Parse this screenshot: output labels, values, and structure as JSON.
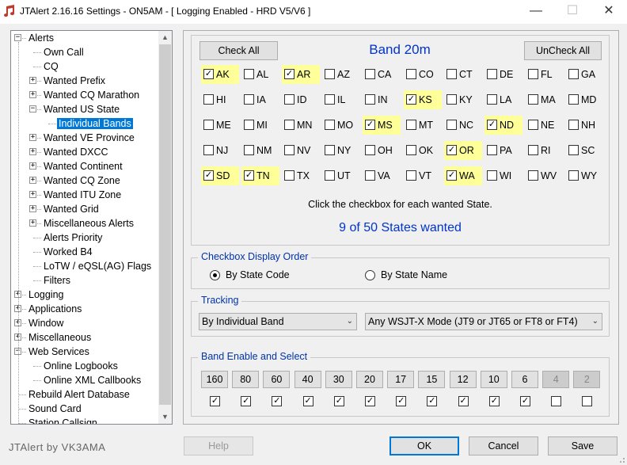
{
  "window": {
    "title": "JTAlert 2.16.16 Settings  -  ON5AM  -  [ Logging Enabled - HRD V5/V6 ]",
    "minimize": "—",
    "maximize": "☐",
    "close": "✕"
  },
  "tree": {
    "items": [
      {
        "label": "Alerts",
        "level": 0,
        "expander": "−"
      },
      {
        "label": "Own Call",
        "level": 1,
        "expander": ""
      },
      {
        "label": "CQ",
        "level": 1,
        "expander": ""
      },
      {
        "label": "Wanted Prefix",
        "level": 1,
        "expander": "+"
      },
      {
        "label": "Wanted CQ Marathon",
        "level": 1,
        "expander": "+"
      },
      {
        "label": "Wanted US State",
        "level": 1,
        "expander": "−"
      },
      {
        "label": "Individual Bands",
        "level": 2,
        "expander": "",
        "selected": true
      },
      {
        "label": "Wanted VE Province",
        "level": 1,
        "expander": "+"
      },
      {
        "label": "Wanted DXCC",
        "level": 1,
        "expander": "+"
      },
      {
        "label": "Wanted Continent",
        "level": 1,
        "expander": "+"
      },
      {
        "label": "Wanted CQ Zone",
        "level": 1,
        "expander": "+"
      },
      {
        "label": "Wanted ITU Zone",
        "level": 1,
        "expander": "+"
      },
      {
        "label": "Wanted Grid",
        "level": 1,
        "expander": "+"
      },
      {
        "label": "Miscellaneous Alerts",
        "level": 1,
        "expander": "+"
      },
      {
        "label": "Alerts Priority",
        "level": 1,
        "expander": ""
      },
      {
        "label": "Worked B4",
        "level": 1,
        "expander": ""
      },
      {
        "label": "LoTW / eQSL(AG) Flags",
        "level": 1,
        "expander": ""
      },
      {
        "label": "Filters",
        "level": 1,
        "expander": ""
      },
      {
        "label": "Logging",
        "level": 0,
        "expander": "+"
      },
      {
        "label": "Applications",
        "level": 0,
        "expander": "+"
      },
      {
        "label": "Window",
        "level": 0,
        "expander": "+"
      },
      {
        "label": "Miscellaneous",
        "level": 0,
        "expander": "+"
      },
      {
        "label": "Web Services",
        "level": 0,
        "expander": "−"
      },
      {
        "label": "Online Logbooks",
        "level": 1,
        "expander": ""
      },
      {
        "label": "Online XML Callbooks",
        "level": 1,
        "expander": ""
      },
      {
        "label": "Rebuild Alert Database",
        "level": 0,
        "expander": ""
      },
      {
        "label": "Sound Card",
        "level": 0,
        "expander": ""
      },
      {
        "label": "Station Callsign",
        "level": 0,
        "expander": ""
      }
    ]
  },
  "band_panel": {
    "check_all": "Check All",
    "uncheck_all": "UnCheck All",
    "title": "Band 20m",
    "states": [
      [
        "AK",
        "AL",
        "AR",
        "AZ",
        "CA",
        "CO",
        "CT",
        "DE",
        "FL",
        "GA"
      ],
      [
        "HI",
        "IA",
        "ID",
        "IL",
        "IN",
        "KS",
        "KY",
        "LA",
        "MA",
        "MD"
      ],
      [
        "ME",
        "MI",
        "MN",
        "MO",
        "MS",
        "MT",
        "NC",
        "ND",
        "NE",
        "NH"
      ],
      [
        "NJ",
        "NM",
        "NV",
        "NY",
        "OH",
        "OK",
        "OR",
        "PA",
        "RI",
        "SC"
      ],
      [
        "SD",
        "TN",
        "TX",
        "UT",
        "VA",
        "VT",
        "WA",
        "WI",
        "WV",
        "WY"
      ]
    ],
    "checked": [
      "AK",
      "AR",
      "KS",
      "MS",
      "ND",
      "OR",
      "SD",
      "TN",
      "WA"
    ],
    "instruction": "Click the checkbox for each wanted State.",
    "summary": "9 of 50 States wanted",
    "check_mark": "✓"
  },
  "display_order": {
    "title": "Checkbox Display Order",
    "option_code": "By State Code",
    "option_name": "By State Name",
    "selected": "code"
  },
  "tracking": {
    "title": "Tracking",
    "band_select": "By Individual Band",
    "mode_select": "Any WSJT-X Mode (JT9 or JT65 or FT8 or FT4)",
    "chevron": "⌄"
  },
  "band_enable": {
    "title": "Band Enable and Select",
    "bands": [
      {
        "label": "160",
        "enabled": true,
        "checked": true
      },
      {
        "label": "80",
        "enabled": true,
        "checked": true
      },
      {
        "label": "60",
        "enabled": true,
        "checked": true
      },
      {
        "label": "40",
        "enabled": true,
        "checked": true
      },
      {
        "label": "30",
        "enabled": true,
        "checked": true
      },
      {
        "label": "20",
        "enabled": true,
        "checked": true
      },
      {
        "label": "17",
        "enabled": true,
        "checked": true
      },
      {
        "label": "15",
        "enabled": true,
        "checked": true
      },
      {
        "label": "12",
        "enabled": true,
        "checked": true
      },
      {
        "label": "10",
        "enabled": true,
        "checked": true
      },
      {
        "label": "6",
        "enabled": true,
        "checked": true
      },
      {
        "label": "4",
        "enabled": false,
        "checked": false
      },
      {
        "label": "2",
        "enabled": false,
        "checked": false
      }
    ]
  },
  "footer": {
    "brand": "JTAlert by VK3AMA",
    "help": "Help",
    "ok": "OK",
    "cancel": "Cancel",
    "save": "Save"
  },
  "colors": {
    "accent_blue": "#0033cc",
    "selected_bg": "#0078d7",
    "highlight_yellow": "#ffff99"
  }
}
